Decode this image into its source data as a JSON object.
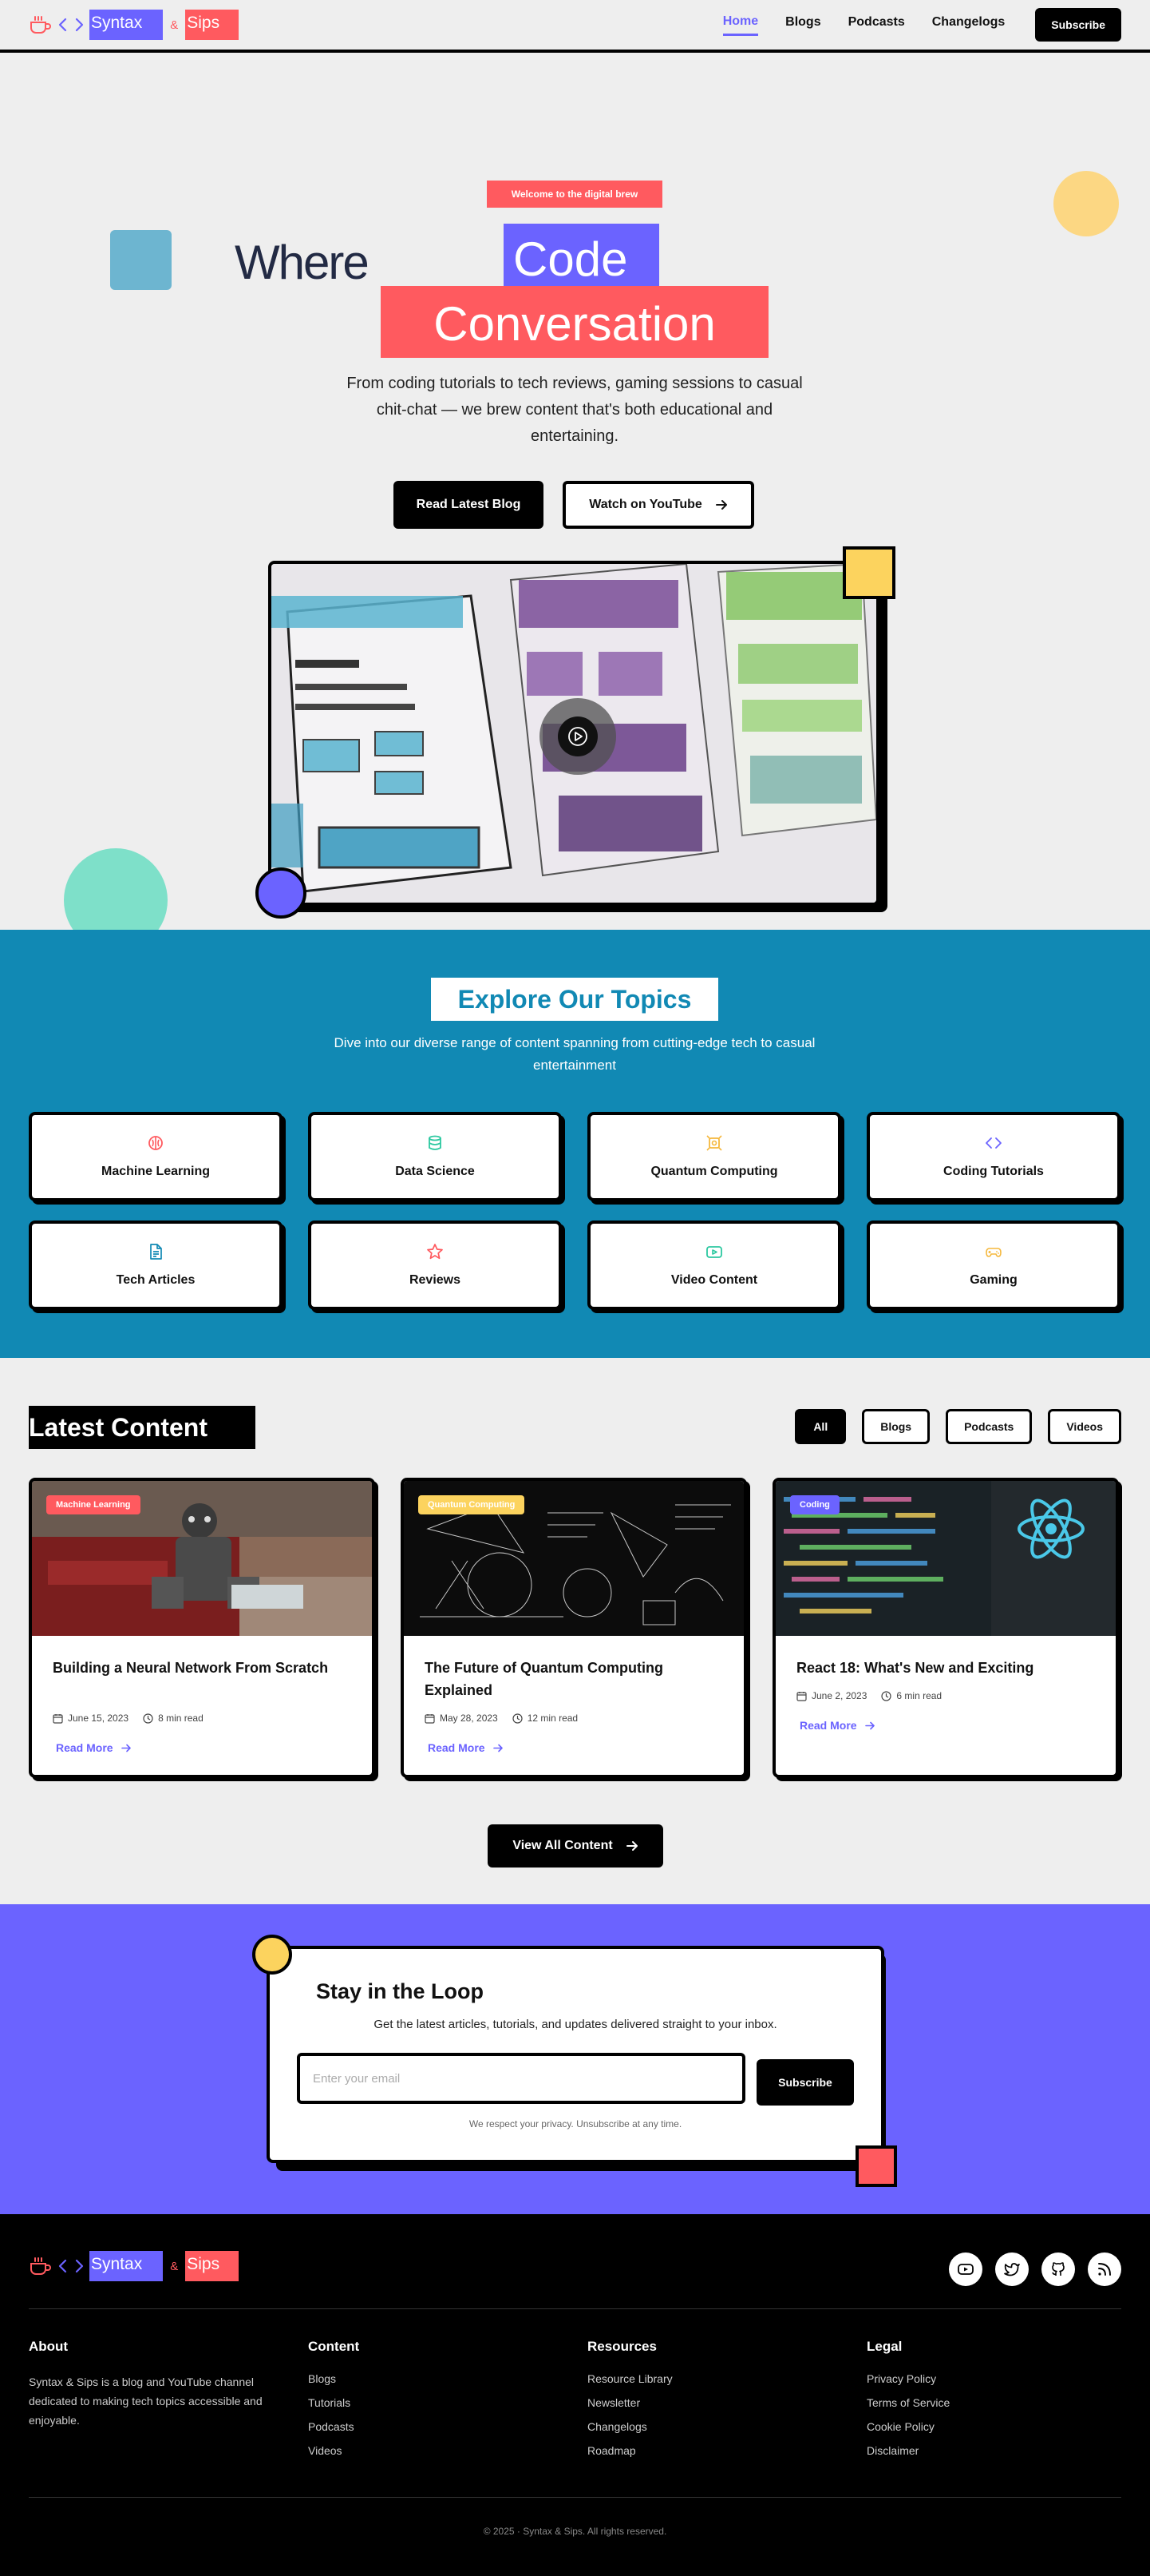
{
  "brand": {
    "word1": "Syntax",
    "amp": "&",
    "word2": "Sips",
    "icons": [
      "coffee-cup-icon",
      "code-brackets-icon"
    ]
  },
  "nav": {
    "links": [
      "Home",
      "Blogs",
      "Podcasts",
      "Changelogs"
    ],
    "active": "Home",
    "subscribe_label": "Subscribe"
  },
  "hero": {
    "badge": "Welcome to the digital brew",
    "heading_word": "Where",
    "heading_highlight1": "Code",
    "heading_highlight2": "Conversation",
    "subtitle": "From coding tutorials to tech reviews, gaming sessions to casual chit-chat — we brew content that's both educational and entertaining.",
    "primary_cta": "Read Latest Blog",
    "secondary_cta": "Watch on YouTube",
    "video_play_icon": "play-icon"
  },
  "topics": {
    "title": "Explore Our Topics",
    "subtitle": "Dive into our diverse range of content spanning from cutting-edge tech to casual entertainment",
    "items": [
      {
        "label": "Machine Learning",
        "icon": "brain-icon",
        "color": "#ff5a5f"
      },
      {
        "label": "Data Science",
        "icon": "database-icon",
        "color": "#2cc8a0"
      },
      {
        "label": "Quantum Computing",
        "icon": "atom-icon",
        "color": "#f5b83d"
      },
      {
        "label": "Coding Tutorials",
        "icon": "code-icon",
        "color": "#6b63ff"
      },
      {
        "label": "Tech Articles",
        "icon": "document-icon",
        "color": "#1189b4"
      },
      {
        "label": "Reviews",
        "icon": "star-icon",
        "color": "#ff5a5f"
      },
      {
        "label": "Video Content",
        "icon": "video-icon",
        "color": "#2cc8a0"
      },
      {
        "label": "Gaming",
        "icon": "gamepad-icon",
        "color": "#f5b83d"
      }
    ]
  },
  "latest": {
    "title": "Latest Content",
    "filters": [
      "All",
      "Blogs",
      "Podcasts",
      "Videos"
    ],
    "active_filter": "All",
    "cards": [
      {
        "tag": "Machine Learning",
        "tag_color": "#ff5a5f",
        "title": "Building a Neural Network From Scratch",
        "date": "June 15, 2023",
        "read_time": "8 min read",
        "cta": "Read More"
      },
      {
        "tag": "Quantum Computing",
        "tag_color": "#fcd35e",
        "title": "The Future of Quantum Computing Explained",
        "date": "May 28, 2023",
        "read_time": "12 min read",
        "cta": "Read More"
      },
      {
        "tag": "Coding",
        "tag_color": "#6b63ff",
        "title": "React 18: What's New and Exciting",
        "date": "June 2, 2023",
        "read_time": "6 min read",
        "cta": "Read More"
      }
    ],
    "view_all": "View All Content"
  },
  "newsletter": {
    "title": "Stay in the Loop",
    "description": "Get the latest articles, tutorials, and updates delivered straight to your inbox.",
    "placeholder": "Enter your email",
    "button": "Subscribe",
    "privacy": "We respect your privacy. Unsubscribe at any time."
  },
  "footer": {
    "socials": [
      "youtube-icon",
      "twitter-icon",
      "github-icon",
      "rss-icon"
    ],
    "about": {
      "heading": "About",
      "text": "Syntax & Sips is a blog and YouTube channel dedicated to making tech topics accessible and enjoyable."
    },
    "columns": [
      {
        "heading": "Content",
        "links": [
          "Blogs",
          "Tutorials",
          "Podcasts",
          "Videos"
        ]
      },
      {
        "heading": "Resources",
        "links": [
          "Resource Library",
          "Newsletter",
          "Changelogs",
          "Roadmap"
        ]
      },
      {
        "heading": "Legal",
        "links": [
          "Privacy Policy",
          "Terms of Service",
          "Cookie Policy",
          "Disclaimer"
        ]
      }
    ],
    "copyright": "© 2025 · Syntax & Sips. All rights reserved."
  },
  "colors": {
    "accent": "#6b63ff",
    "coral": "#ff5a5f",
    "teal_blue": "#1189b4",
    "yellow": "#fcd35e",
    "mint": "#7ee0c9"
  }
}
